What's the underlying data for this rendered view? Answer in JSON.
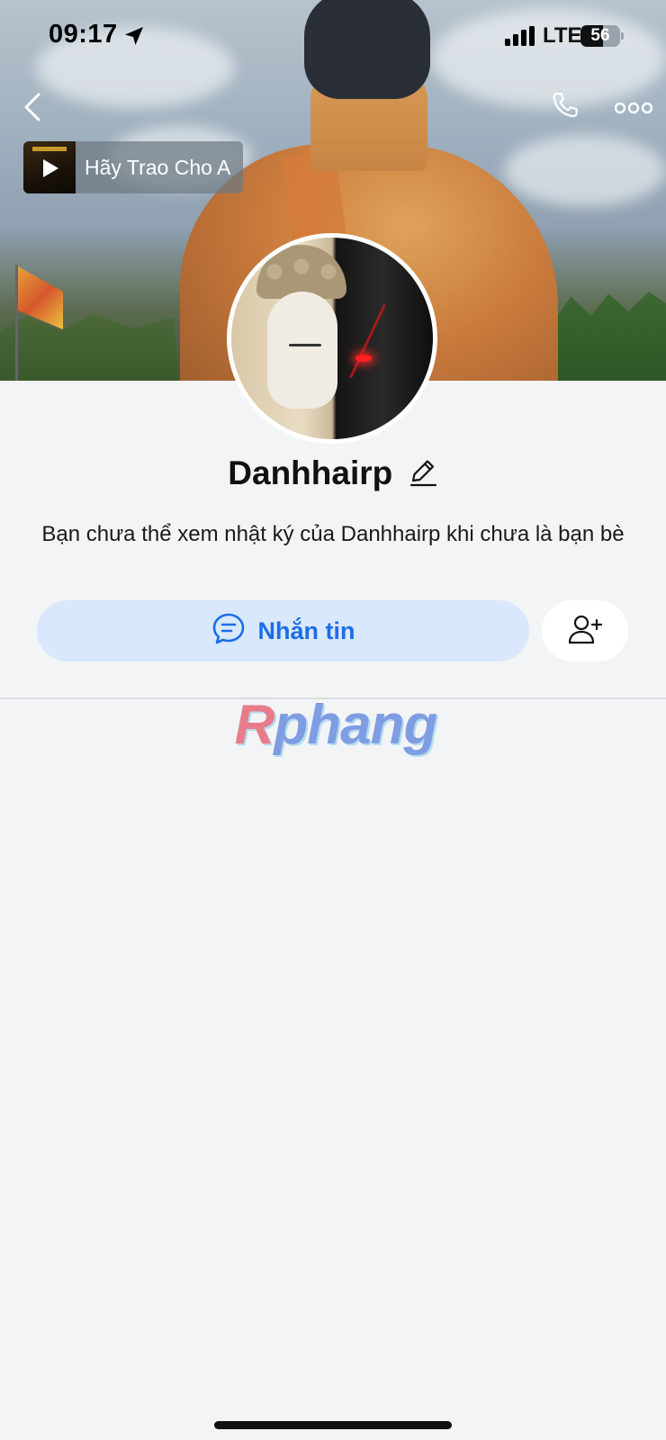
{
  "status_bar": {
    "time": "09:17",
    "network": "LTE",
    "battery_level": "56",
    "battery_percent": 56
  },
  "nav": {
    "back_icon": "chevron-left-icon",
    "call_icon": "phone-icon",
    "more_icon": "more-dots-icon"
  },
  "music": {
    "title": "Hãy Trao Cho A",
    "play_icon": "play-icon"
  },
  "profile": {
    "name": "Danhhairp",
    "edit_icon": "pencil-icon",
    "notice": "Bạn chưa thể xem nhật ký của Danhhairp khi chưa là bạn bè"
  },
  "actions": {
    "message_label": "Nhắn tin",
    "message_icon": "chat-bubble-icon",
    "add_friend_icon": "add-friend-icon"
  },
  "watermark": {
    "first": "R",
    "rest": "phang"
  },
  "colors": {
    "accent": "#1a6ee8",
    "message_button_bg": "#d9e8fc",
    "page_bg": "#f3f4f6"
  }
}
